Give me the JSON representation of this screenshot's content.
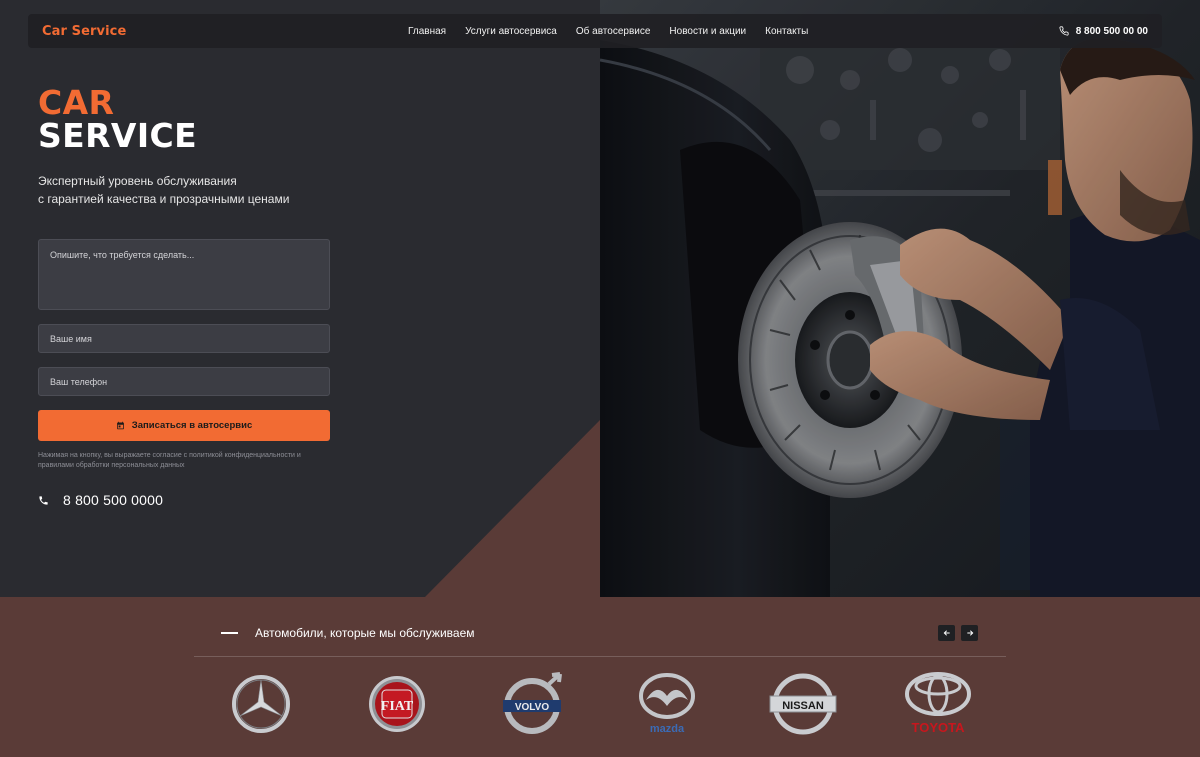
{
  "colors": {
    "accent": "#f26b33",
    "hero_bg": "#2a2b30",
    "brown": "#5a3b37"
  },
  "navbar": {
    "brand": "Car Service",
    "links": [
      "Главная",
      "Услуги автосервиса",
      "Об автосервисе",
      "Новости и акции",
      "Контакты"
    ],
    "phone": "8 800 500 00 00",
    "phone_icon": "phone-icon"
  },
  "hero": {
    "title_line1": "CAR",
    "title_line2": "SERVICE",
    "subtitle_line1": "Экспертный уровень обслуживания",
    "subtitle_line2": "с гарантией качества и прозрачными ценами"
  },
  "form": {
    "message_placeholder": "Опишите, что требуется сделать...",
    "name_placeholder": "Ваше имя",
    "phone_placeholder": "Ваш телефон",
    "submit_label": "Записаться в автосервис",
    "submit_icon": "calendar-icon",
    "consent": "Нажимая на кнопку, вы выражаете согласие с политикой конфиденциальности и правилами обработки персональных данных"
  },
  "contact": {
    "phone": "8 800 500 0000",
    "phone_icon": "phone-icon"
  },
  "brands": {
    "title": "Автомобили, которые мы обслуживаем",
    "list": [
      {
        "name": "Mercedes-Benz",
        "logo_text": ""
      },
      {
        "name": "Fiat",
        "logo_text": "FIAT"
      },
      {
        "name": "Volvo",
        "logo_text": "VOLVO"
      },
      {
        "name": "Mazda",
        "logo_text": "mazda"
      },
      {
        "name": "Nissan",
        "logo_text": "NISSAN"
      },
      {
        "name": "Toyota",
        "logo_text": "TOYOTA"
      }
    ],
    "prev_icon": "arrow-left-icon",
    "next_icon": "arrow-right-icon"
  }
}
